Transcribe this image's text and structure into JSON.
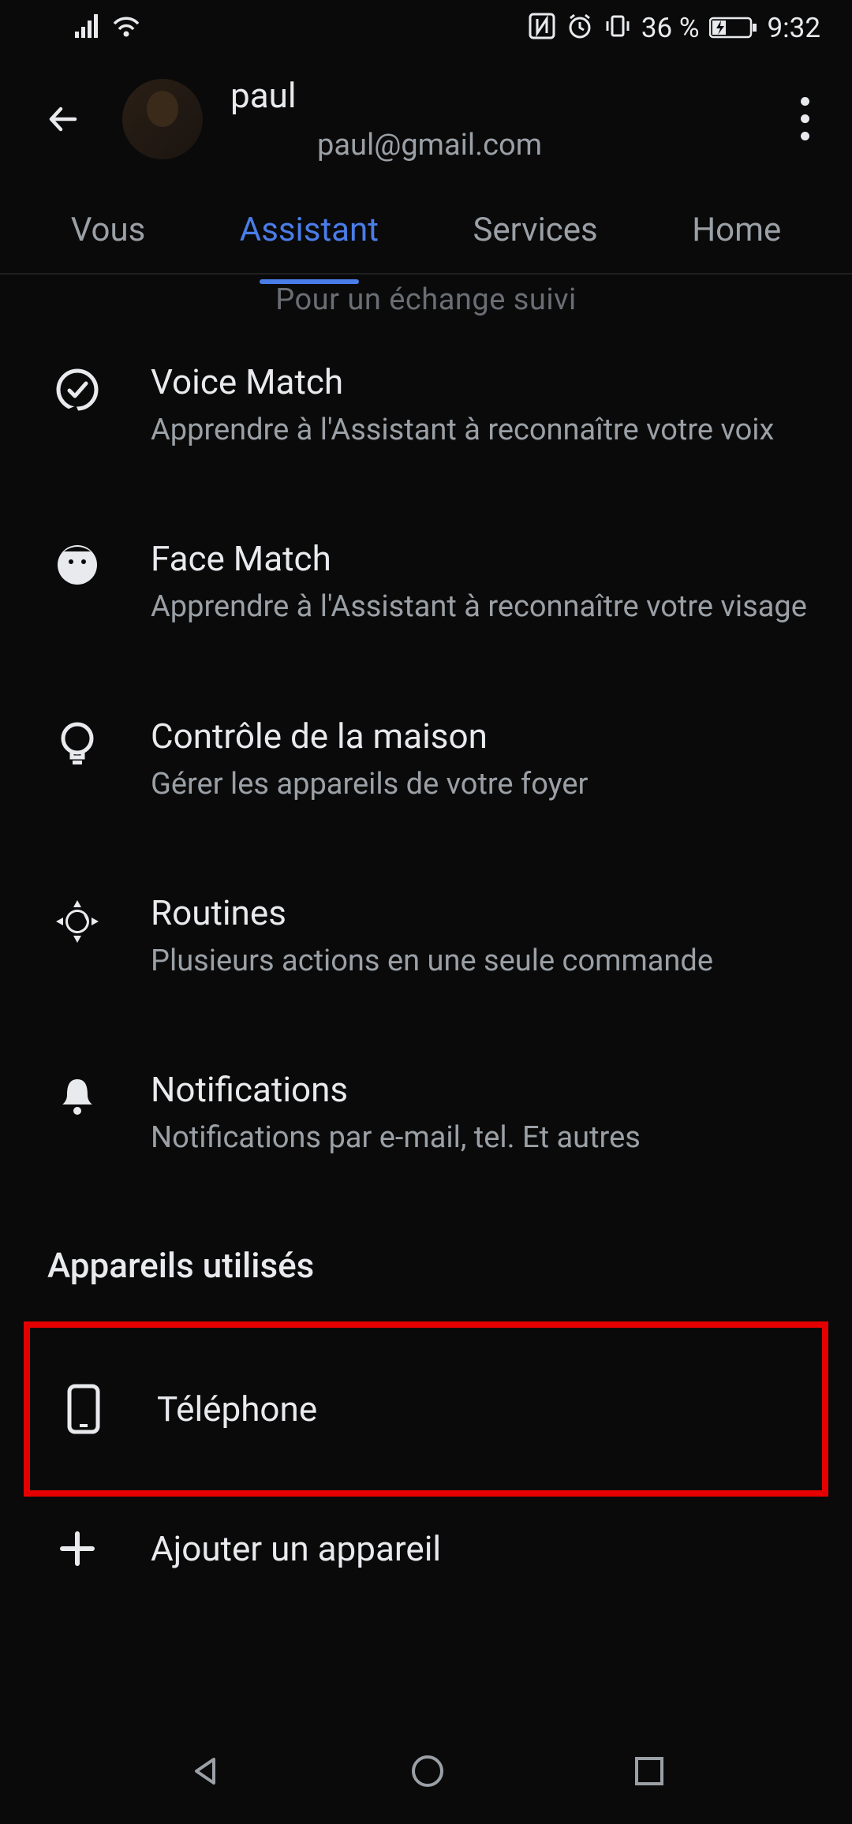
{
  "status": {
    "battery_text": "36 %",
    "time": "9:32"
  },
  "header": {
    "user_name": "paul",
    "user_email": "paul@gmail.com"
  },
  "tabs": [
    {
      "label": "Vous",
      "active": false
    },
    {
      "label": "Assistant",
      "active": true
    },
    {
      "label": "Services",
      "active": false
    },
    {
      "label": "Home",
      "active": false
    }
  ],
  "partial_top_text": "Pour un échange suivi",
  "settings": [
    {
      "title": "Voice Match",
      "subtitle": "Apprendre à l'Assistant à reconnaître votre voix"
    },
    {
      "title": "Face Match",
      "subtitle": "Apprendre à l'Assistant à reconnaître votre visage"
    },
    {
      "title": "Contrôle de la maison",
      "subtitle": "Gérer les appareils de votre foyer"
    },
    {
      "title": "Routines",
      "subtitle": "Plusieurs actions en une seule commande"
    },
    {
      "title": "Notifications",
      "subtitle": "Notifications par e-mail, tel. Et autres"
    }
  ],
  "devices_section": {
    "title": "Appareils utilisés",
    "items": [
      {
        "label": "Téléphone"
      },
      {
        "label": "Ajouter un appareil"
      }
    ]
  }
}
